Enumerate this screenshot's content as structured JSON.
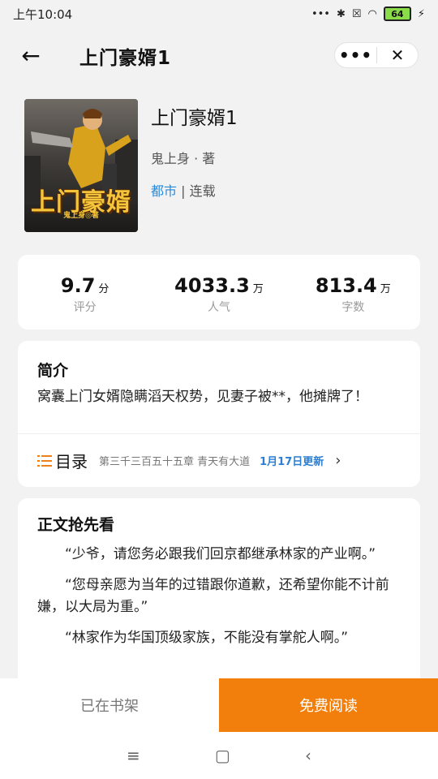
{
  "status_bar": {
    "time": "上午10:04",
    "battery": "64",
    "icons": [
      "dots-icon",
      "bluetooth-icon",
      "sim-icon",
      "wifi-icon",
      "battery-icon",
      "charging-icon"
    ]
  },
  "nav": {
    "title": "上门豪婿1",
    "more_glyph": "•••",
    "close_glyph": "✕",
    "back_glyph": "←"
  },
  "book": {
    "cover_title": "上门豪婿",
    "cover_author": "鬼上身◎著",
    "title": "上门豪婿1",
    "author_line": "鬼上身 · 著",
    "category": "都市",
    "separator": " | ",
    "status": "连载"
  },
  "stats": [
    {
      "value": "9.7",
      "unit": "分",
      "label": "评分"
    },
    {
      "value": "4033.3",
      "unit": "万",
      "label": "人气"
    },
    {
      "value": "813.4",
      "unit": "万",
      "label": "字数"
    }
  ],
  "intro": {
    "heading": "简介",
    "text": "窝囊上门女婿隐瞒滔天权势，见妻子被**，他摊牌了！"
  },
  "toc": {
    "label": "目录",
    "latest_chapter": "第三千三百五十五章 青天有大道",
    "updated": "1月17日更新",
    "chevron": "›"
  },
  "preview": {
    "heading": "正文抢先看",
    "paragraphs": [
      "“少爷，请您务必跟我们回京都继承林家的产业啊。”",
      "“您母亲愿为当年的过错跟你道歉，还希望你能不计前嫌，以大局为重。”",
      "“林家作为华国顶级家族，不能没有掌舵人啊。”"
    ]
  },
  "actions": {
    "shelf": "已在书架",
    "read": "免费阅读"
  },
  "system_nav": {
    "menu": "≡",
    "home": "▢",
    "back": "‹"
  },
  "colors": {
    "accent": "#f27f0c",
    "link": "#2b8ad8",
    "background": "#f2f2f2"
  }
}
